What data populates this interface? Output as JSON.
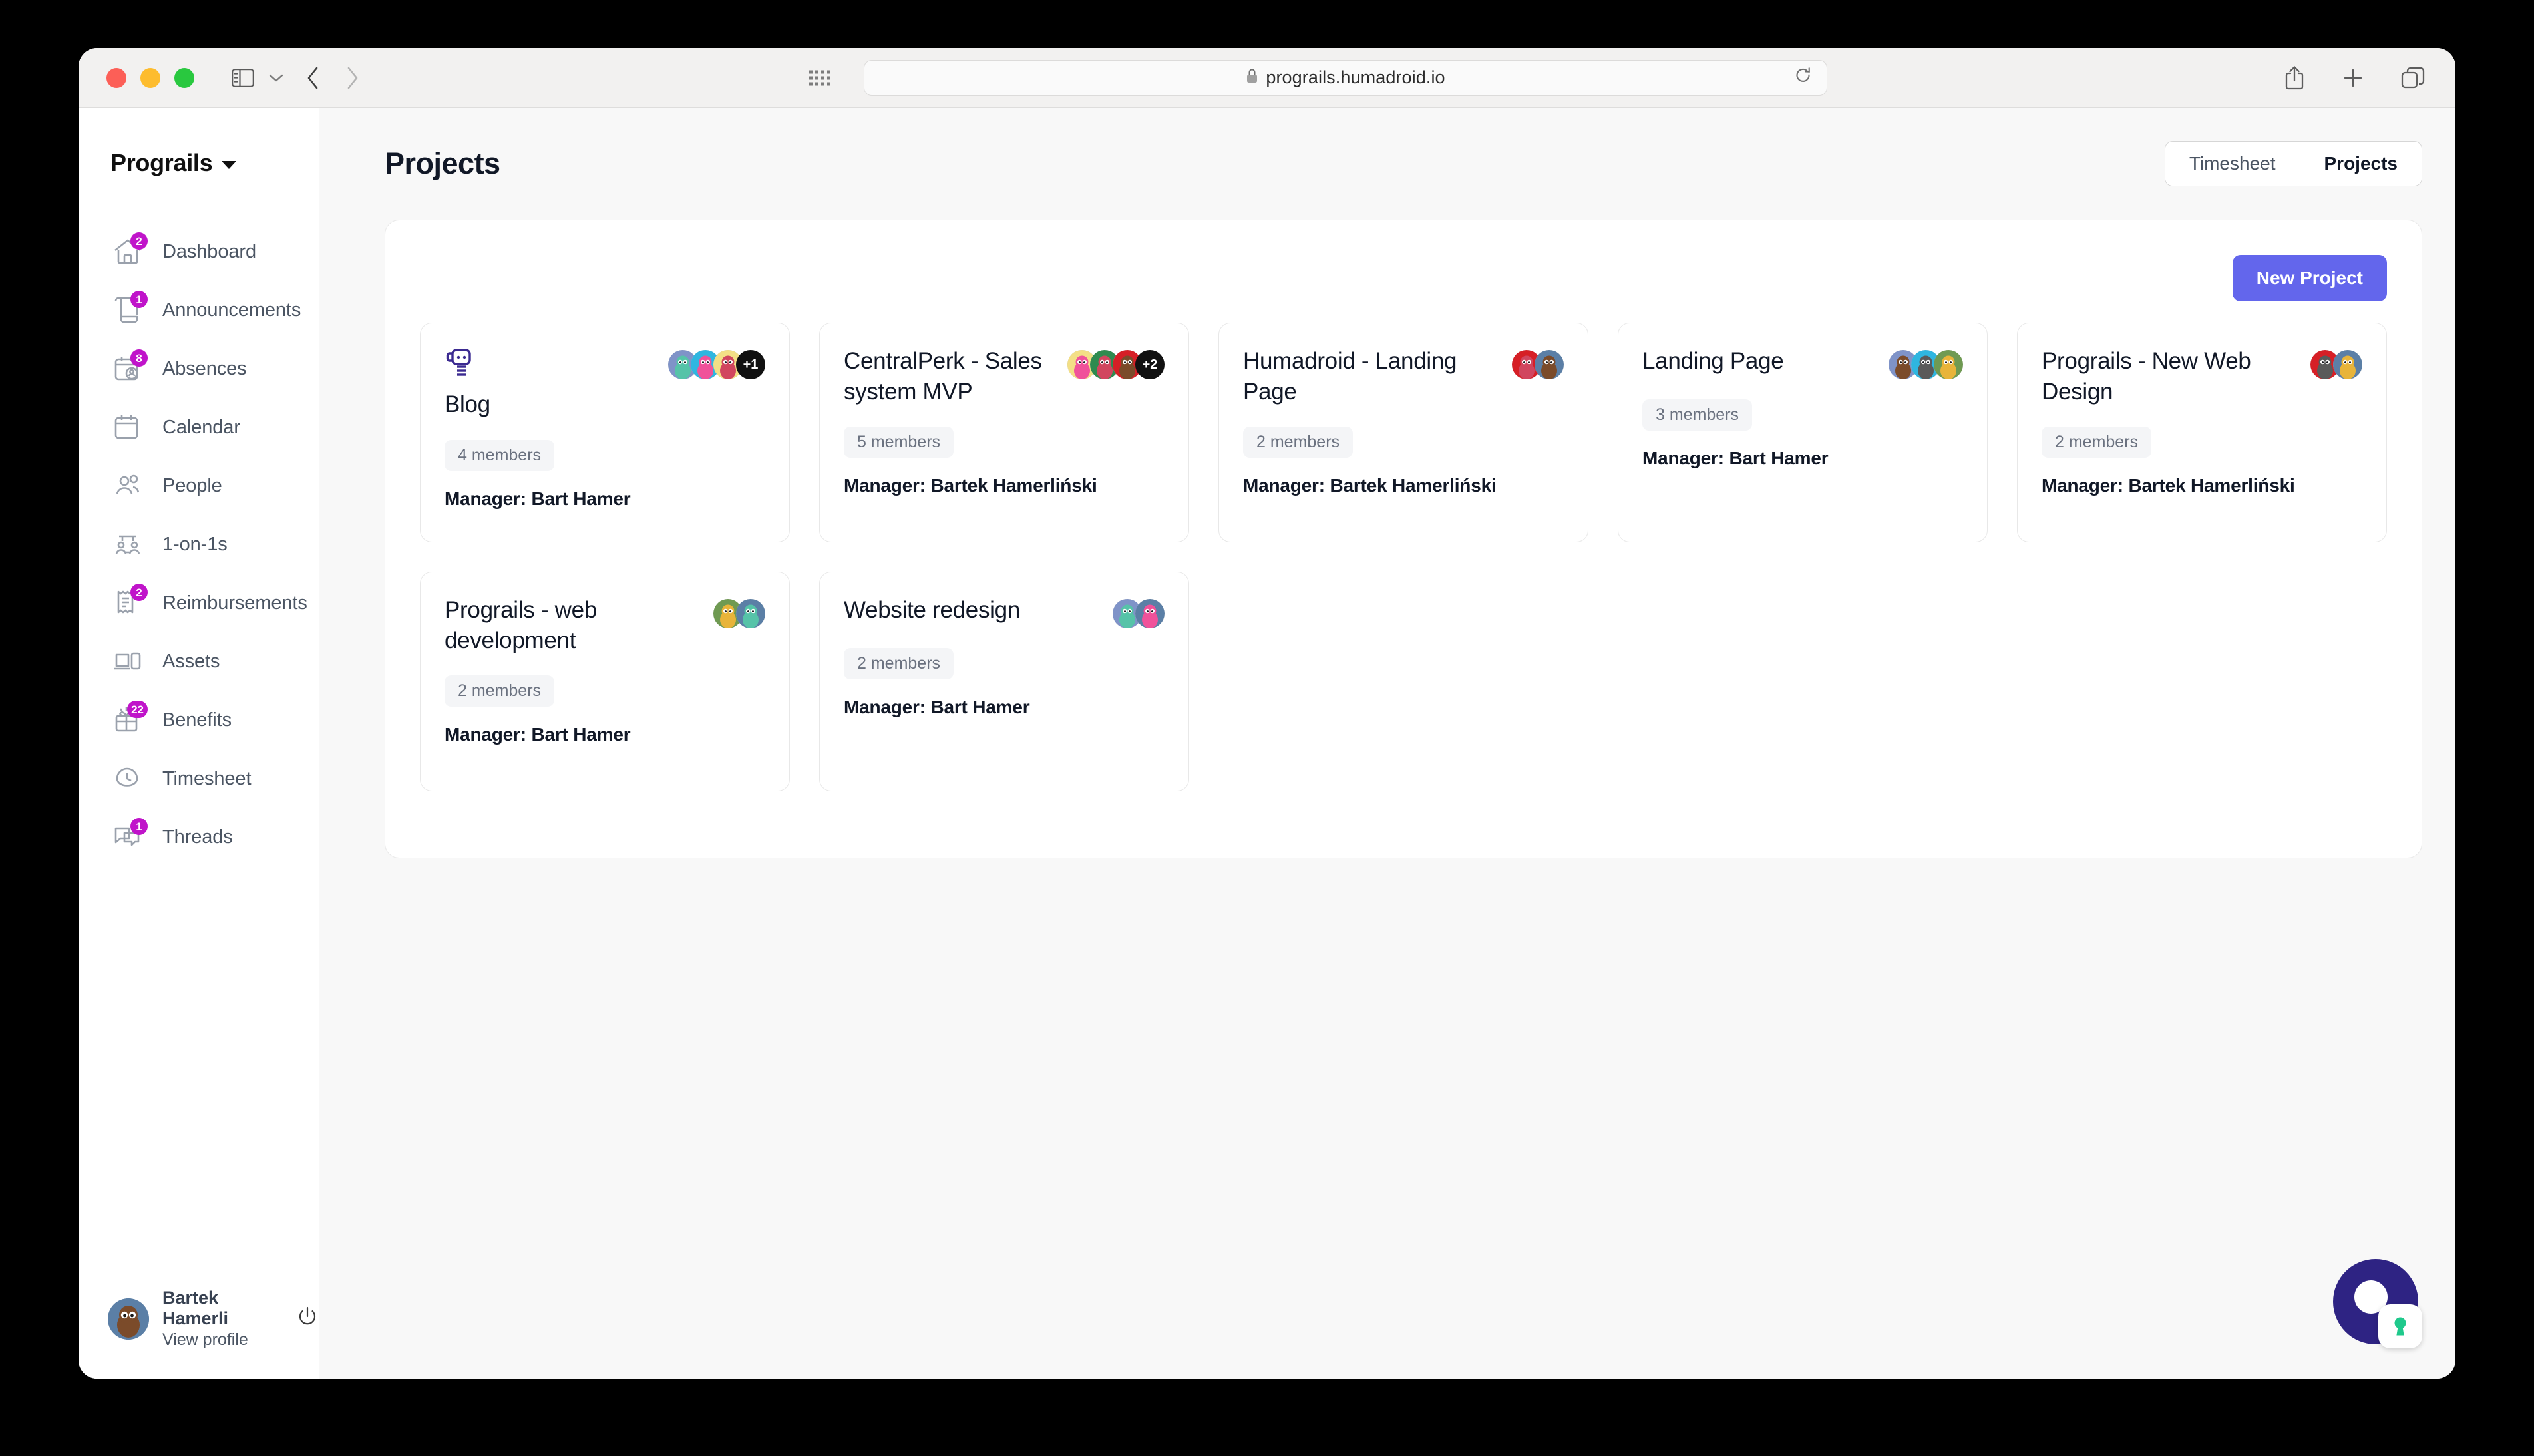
{
  "browser": {
    "url": "prograils.humadroid.io",
    "lock_icon": "lock-icon",
    "reload_icon": "reload-icon",
    "back_icon": "chevron-left-icon",
    "forward_icon": "chevron-right-icon",
    "sidebar_icon": "sidebar-toggle-icon",
    "chevron_icon": "chevron-down-icon",
    "grid_icon": "app-grid-icon",
    "share_icon": "share-icon",
    "new_tab_icon": "plus-icon",
    "tabs_icon": "tab-overview-icon"
  },
  "sidebar": {
    "brand": "Prograils",
    "items": [
      {
        "label": "Dashboard",
        "icon": "home-icon",
        "badge": "2"
      },
      {
        "label": "Announcements",
        "icon": "scroll-icon",
        "badge": "1"
      },
      {
        "label": "Absences",
        "icon": "calendar-user-icon",
        "badge": "8"
      },
      {
        "label": "Calendar",
        "icon": "calendar-icon",
        "badge": ""
      },
      {
        "label": "People",
        "icon": "people-icon",
        "badge": ""
      },
      {
        "label": "1-on-1s",
        "icon": "one-on-one-icon",
        "badge": ""
      },
      {
        "label": "Reimbursements",
        "icon": "receipt-icon",
        "badge": "2"
      },
      {
        "label": "Assets",
        "icon": "devices-icon",
        "badge": ""
      },
      {
        "label": "Benefits",
        "icon": "gift-icon",
        "badge": "22"
      },
      {
        "label": "Timesheet",
        "icon": "clock-icon",
        "badge": ""
      },
      {
        "label": "Threads",
        "icon": "chat-icon",
        "badge": "1"
      }
    ],
    "user": {
      "name": "Bartek Hamerli",
      "link": "View profile",
      "logout_icon": "power-icon"
    }
  },
  "header": {
    "title": "Projects",
    "toggle": {
      "timesheet": "Timesheet",
      "projects": "Projects",
      "active": "Projects"
    }
  },
  "panel": {
    "new_project_label": "New Project",
    "accent_color": "#6366ec",
    "projects": [
      {
        "title": "Blog",
        "has_robot_icon": true,
        "members": "4 members",
        "manager": "Manager: Bart Hamer",
        "avatars": [
          "#7f93c8",
          "#2fb6e0",
          "#f3df86"
        ],
        "more": "+1"
      },
      {
        "title": "CentralPerk - Sales system MVP",
        "has_robot_icon": false,
        "members": "5 members",
        "manager": "Manager: Bartek Hamerliński",
        "avatars": [
          "#f3df86",
          "#2e8b4f",
          "#d61f26"
        ],
        "more": "+2"
      },
      {
        "title": "Humadroid - Landing Page",
        "has_robot_icon": false,
        "members": "2 members",
        "manager": "Manager: Bartek Hamerliński",
        "avatars": [
          "#d61f26",
          "#5b7fa6"
        ],
        "more": ""
      },
      {
        "title": "Landing Page",
        "has_robot_icon": false,
        "members": "3 members",
        "manager": "Manager: Bart Hamer",
        "avatars": [
          "#7f93c8",
          "#2fb6e0",
          "#6f9a52"
        ],
        "more": ""
      },
      {
        "title": "Prograils - New Web Design",
        "has_robot_icon": false,
        "members": "2 members",
        "manager": "Manager: Bartek Hamerliński",
        "avatars": [
          "#d61f26",
          "#5b7fa6"
        ],
        "more": ""
      },
      {
        "title": "Prograils - web development",
        "has_robot_icon": false,
        "members": "2 members",
        "manager": "Manager: Bart Hamer",
        "avatars": [
          "#6f9a52",
          "#5b7fa6"
        ],
        "more": ""
      },
      {
        "title": "Website redesign",
        "has_robot_icon": false,
        "members": "2 members",
        "manager": "Manager: Bart Hamer",
        "avatars": [
          "#7f93c8",
          "#5b7fa6"
        ],
        "more": ""
      }
    ]
  },
  "chat_widget": {
    "icon": "chat-launcher-icon",
    "badge_icon": "keyhole-icon",
    "circle_color": "#2e2383",
    "keyhole_color": "#1fc98c"
  }
}
